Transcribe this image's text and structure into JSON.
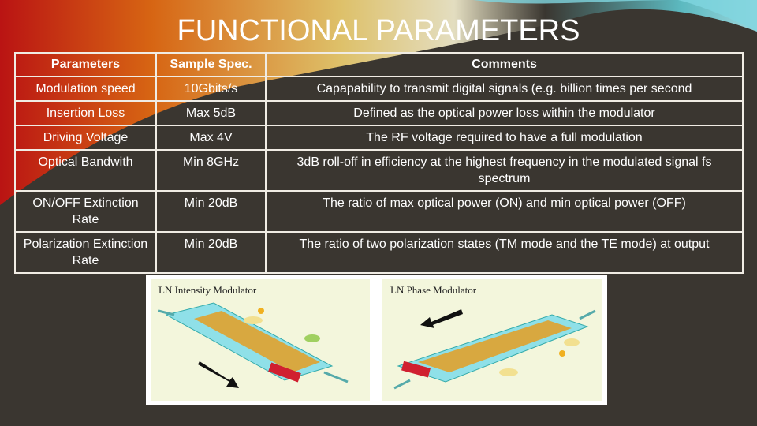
{
  "title": "FUNCTIONAL PARAMETERS",
  "table": {
    "headers": [
      "Parameters",
      "Sample Spec.",
      "Comments"
    ],
    "rows": [
      [
        "Modulation speed",
        "10Gbits/s",
        "Capapability to transmit digital signals (e.g. billion times per second"
      ],
      [
        "Insertion Loss",
        "Max 5dB",
        "Defined as the optical power loss within the modulator"
      ],
      [
        "Driving Voltage",
        "Max 4V",
        "The RF voltage required to have a full modulation"
      ],
      [
        "Optical Bandwith",
        "Min 8GHz",
        "3dB roll-off in efficiency at the highest frequency in the modulated signal fs spectrum"
      ],
      [
        "ON/OFF Extinction Rate",
        "Min 20dB",
        "The ratio of max optical power (ON) and min optical power (OFF)"
      ],
      [
        "Polarization Extinction Rate",
        "Min 20dB",
        "The ratio of two polarization states (TM mode and the TE mode) at output"
      ]
    ]
  },
  "figure": {
    "left_caption": "LN Intensity Modulator",
    "right_caption": "LN Phase Modulator"
  }
}
